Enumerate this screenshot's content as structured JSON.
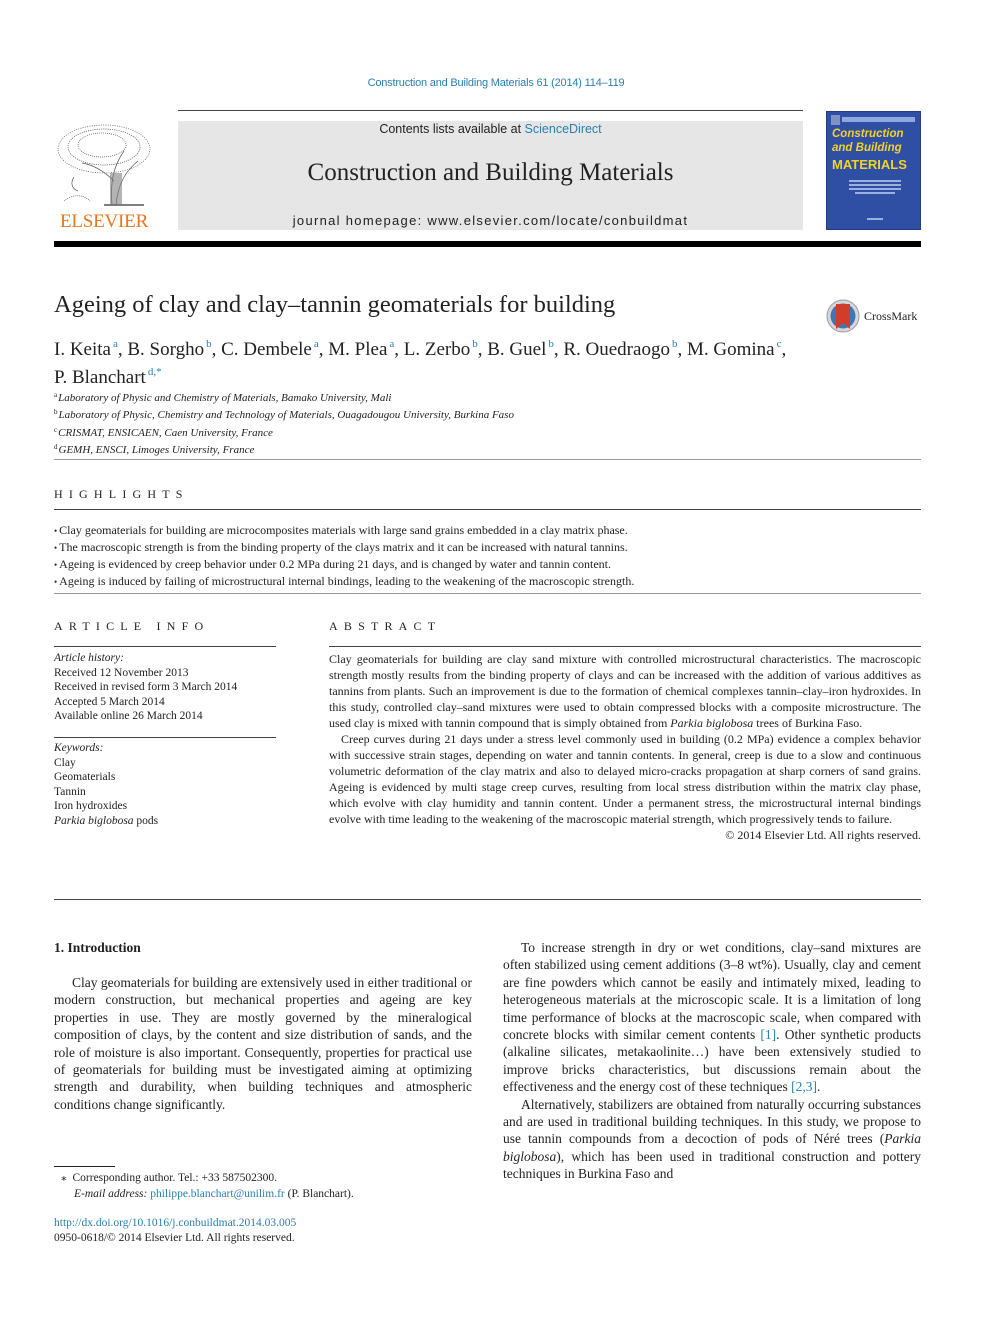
{
  "header": {
    "citation": "Construction and Building Materials 61 (2014) 114–119",
    "contents_prefix": "Contents lists available at ",
    "contents_link": "ScienceDirect",
    "journal_title": "Construction and Building Materials",
    "homepage": "journal homepage: www.elsevier.com/locate/conbuildmat",
    "publisher_logo": "ELSEVIER",
    "cover": {
      "line1": "Construction",
      "line2": "and Building",
      "line3": "MATERIALS",
      "background": "#2f4fa5",
      "text_color": "#f3d22a"
    },
    "crossmark_label": "CrossMark"
  },
  "article": {
    "title": "Ageing of clay and clay–tannin geomaterials for building",
    "authors": [
      {
        "name": "I. Keita",
        "aff": "a",
        "sep": ", "
      },
      {
        "name": "B. Sorgho",
        "aff": "b",
        "sep": ", "
      },
      {
        "name": "C. Dembele",
        "aff": "a",
        "sep": ", "
      },
      {
        "name": "M. Plea",
        "aff": "a",
        "sep": ", "
      },
      {
        "name": "L. Zerbo",
        "aff": "b",
        "sep": ", "
      },
      {
        "name": "B. Guel",
        "aff": "b",
        "sep": ", "
      },
      {
        "name": "R. Ouedraogo",
        "aff": "b",
        "sep": ", "
      },
      {
        "name": "M. Gomina",
        "aff": "c",
        "sep": ","
      },
      {
        "name": "P. Blanchart",
        "aff": "d,*",
        "sep": ""
      }
    ],
    "affiliations": [
      {
        "key": "a",
        "text": "Laboratory of Physic and Chemistry of Materials, Bamako University, Mali"
      },
      {
        "key": "b",
        "text": "Laboratory of Physic, Chemistry and Technology of Materials, Ouagadougou University, Burkina Faso"
      },
      {
        "key": "c",
        "text": "CRISMAT, ENSICAEN, Caen University, France"
      },
      {
        "key": "d",
        "text": "GEMH, ENSCI, Limoges University, France"
      }
    ]
  },
  "highlights": {
    "heading": "HIGHLIGHTS",
    "items": [
      "Clay geomaterials for building are microcomposites materials with large sand grains embedded in a clay matrix phase.",
      "The macroscopic strength is from the binding property of the clays matrix and it can be increased with natural tannins.",
      "Ageing is evidenced by creep behavior under 0.2 MPa during 21 days, and is changed by water and tannin content.",
      "Ageing is induced by failing of microstructural internal bindings, leading to the weakening of the macroscopic strength."
    ]
  },
  "article_info": {
    "heading": "ARTICLE INFO",
    "history_label": "Article history:",
    "history": [
      "Received 12 November 2013",
      "Received in revised form 3 March 2014",
      "Accepted 5 March 2014",
      "Available online 26 March 2014"
    ],
    "keywords_label": "Keywords:",
    "keywords": [
      "Clay",
      "Geomaterials",
      "Tannin",
      "Iron hydroxides"
    ],
    "keyword_last_italic": "Parkia biglobosa",
    "keyword_last_rest": " pods"
  },
  "abstract": {
    "heading": "ABSTRACT",
    "p1_a": "Clay geomaterials for building are clay sand mixture with controlled microstructural characteristics. The macroscopic strength mostly results from the binding property of clays and can be increased with the addition of various additives as tannins from plants. Such an improvement is due to the formation of chemical complexes tannin–clay–iron hydroxides. In this study, controlled clay–sand mixtures were used to obtain compressed blocks with a composite microstructure. The used clay is mixed with tannin compound that is simply obtained from ",
    "p1_italic": "Parkia biglobosa",
    "p1_b": " trees of Burkina Faso.",
    "p2": "Creep curves during 21 days under a stress level commonly used in building (0.2 MPa) evidence a complex behavior with successive strain stages, depending on water and tannin contents. In general, creep is due to a slow and continuous volumetric deformation of the clay matrix and also to delayed micro-cracks propagation at sharp corners of sand grains. Ageing is evidenced by multi stage creep curves, resulting from local stress distribution within the matrix clay phase, which evolve with clay humidity and tannin content. Under a permanent stress, the microstructural internal bindings evolve with time leading to the weakening of the macroscopic material strength, which progressively tends to failure.",
    "copyright": "© 2014 Elsevier Ltd. All rights reserved."
  },
  "intro": {
    "heading": "1. Introduction",
    "left_p1": "Clay geomaterials for building are extensively used in either traditional or modern construction, but mechanical properties and ageing are key properties in use. They are mostly governed by the mineralogical composition of clays, by the content and size distribution of sands, and the role of moisture is also important. Consequently, properties for practical use of geomaterials for building must be investigated aiming at optimizing strength and durability, when building techniques and atmospheric conditions change significantly.",
    "right_p1_a": "To increase strength in dry or wet conditions, clay–sand mixtures are often stabilized using cement additions (3–8 wt%). Usually, clay and cement are fine powders which cannot be easily and intimately mixed, leading to heterogeneous materials at the microscopic scale. It is a limitation of long time performance of blocks at the macroscopic scale, when compared with concrete blocks with similar cement contents ",
    "ref1": "[1]",
    "right_p1_b": ". Other synthetic products (alkaline silicates, metakaolinite…) have been extensively studied to improve bricks characteristics, but discussions remain about the effectiveness and the energy cost of these techniques ",
    "ref23": "[2,3]",
    "right_p1_c": ".",
    "right_p2_a": "Alternatively, stabilizers are obtained from naturally occurring substances and are used in traditional building techniques. In this study, we propose to use tannin compounds from a decoction of pods of Néré trees (",
    "right_p2_italic": "Parkia biglobosa",
    "right_p2_b": "), which has been used in traditional construction and pottery techniques in Burkina Faso and"
  },
  "footnote": {
    "star": "⁎",
    "corresponding": "Corresponding author. Tel.: +33 587502300.",
    "email_label": "E-mail address: ",
    "email": "philippe.blanchart@unilim.fr",
    "email_suffix": " (P. Blanchart).",
    "doi": "http://dx.doi.org/10.1016/j.conbuildmat.2014.03.005",
    "issn": "0950-0618/© 2014 Elsevier Ltd. All rights reserved."
  },
  "colors": {
    "link": "#2a7fae",
    "elsevier_orange": "#e8761f",
    "masthead_gray": "#e6e6e6"
  }
}
